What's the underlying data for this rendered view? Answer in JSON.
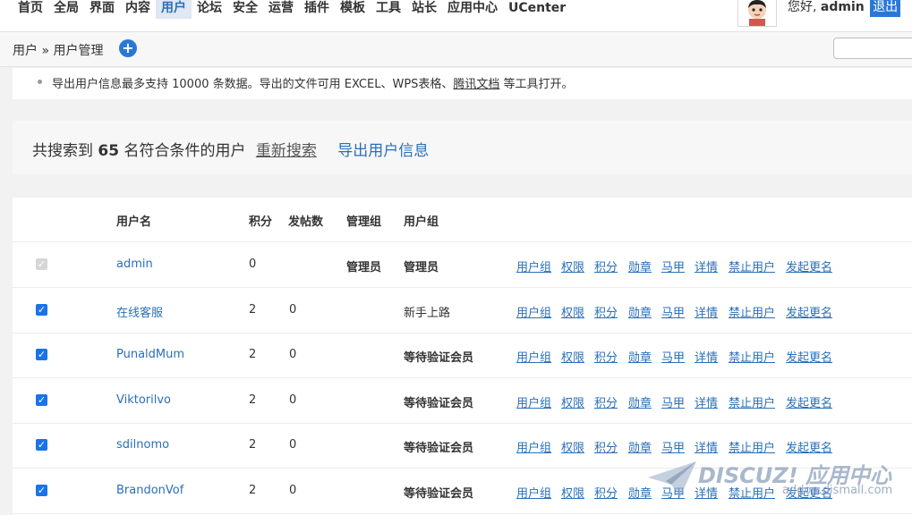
{
  "nav": {
    "items": [
      "首页",
      "全局",
      "界面",
      "内容",
      "用户",
      "论坛",
      "安全",
      "运营",
      "插件",
      "模板",
      "工具",
      "站长",
      "应用中心",
      "UCenter"
    ],
    "active": "用户",
    "greeting": "您好,",
    "username": "admin",
    "logout": "退出"
  },
  "breadcrumb": {
    "text": "用户 » 用户管理"
  },
  "plus_icon": "plus-icon",
  "tip": {
    "text_before": "导出用户信息最多支持 10000 条数据。导出的文件可用 EXCEL、WPS表格、",
    "link": "腾讯文档",
    "text_after": " 等工具打开。"
  },
  "result": {
    "prefix": "共搜索到",
    "count": "65",
    "suffix": "名符合条件的用户",
    "research": "重新搜索",
    "export": "导出用户信息"
  },
  "table": {
    "headers": [
      "用户名",
      "积分",
      "发帖数",
      "管理组",
      "用户组"
    ],
    "actions": [
      "用户组",
      "权限",
      "积分",
      "勋章",
      "马甲",
      "详情",
      "禁止用户",
      "发起更名"
    ],
    "rows": [
      {
        "username": "admin",
        "credits": "0",
        "posts": "",
        "admin_group": "管理员",
        "user_group": "管理员",
        "checked": true,
        "disabled": true
      },
      {
        "username": "在线客服",
        "credits": "2",
        "posts": "0",
        "admin_group": "",
        "user_group": "新手上路",
        "checked": true,
        "disabled": false
      },
      {
        "username": "PunaldMum",
        "credits": "2",
        "posts": "0",
        "admin_group": "",
        "user_group": "等待验证会员",
        "checked": true,
        "disabled": false
      },
      {
        "username": "Viktorilvo",
        "credits": "2",
        "posts": "0",
        "admin_group": "",
        "user_group": "等待验证会员",
        "checked": true,
        "disabled": false
      },
      {
        "username": "sdilnomo",
        "credits": "2",
        "posts": "0",
        "admin_group": "",
        "user_group": "等待验证会员",
        "checked": true,
        "disabled": false
      },
      {
        "username": "BrandonVof",
        "credits": "2",
        "posts": "0",
        "admin_group": "",
        "user_group": "等待验证会员",
        "checked": true,
        "disabled": false
      }
    ]
  },
  "watermark": {
    "main": "DISCUZ! 应用中心",
    "sub": "addon.dismall.com"
  },
  "colors": {
    "accent": "#2a78d6",
    "link": "#2a6fb8",
    "checkbox": "#1a73e8"
  }
}
